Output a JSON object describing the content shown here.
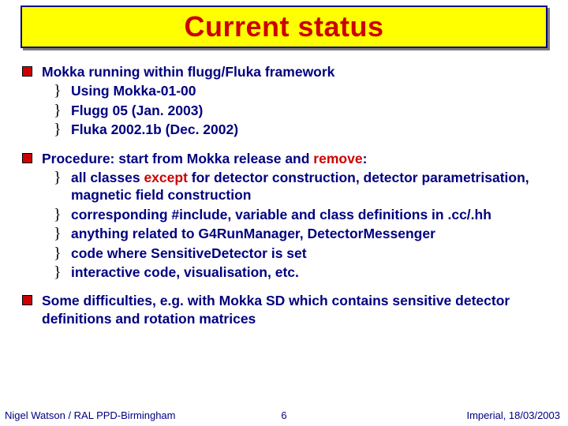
{
  "title": "Current status",
  "bullets": [
    {
      "text": "Mokka running within flugg/Fluka framework",
      "sub": [
        "Using Mokka-01-00",
        "Flugg 05 (Jan. 2003)",
        "Fluka 2002.1b (Dec. 2002)"
      ]
    },
    {
      "text_html": "Procedure: start from Mokka release and <span class=\"red\">remove</span>:",
      "sub_html": [
        "all classes <span class=\"red\">except</span> for detector construction, detector parametrisation, magnetic field construction",
        "corresponding #include, variable and class definitions in .cc/.hh",
        "anything related to G4RunManager, DetectorMessenger",
        "code where SensitiveDetector is set",
        "interactive code, visualisation, etc."
      ]
    },
    {
      "text": "Some difficulties, e.g. with Mokka SD which contains sensitive detector definitions and rotation matrices"
    }
  ],
  "footer": {
    "left": "Nigel Watson / RAL PPD-Birmingham",
    "center": "6",
    "right": "Imperial, 18/03/2003"
  },
  "colors": {
    "accent_red": "#cc0000",
    "navy": "#000080",
    "title_bg": "#ffff00"
  }
}
